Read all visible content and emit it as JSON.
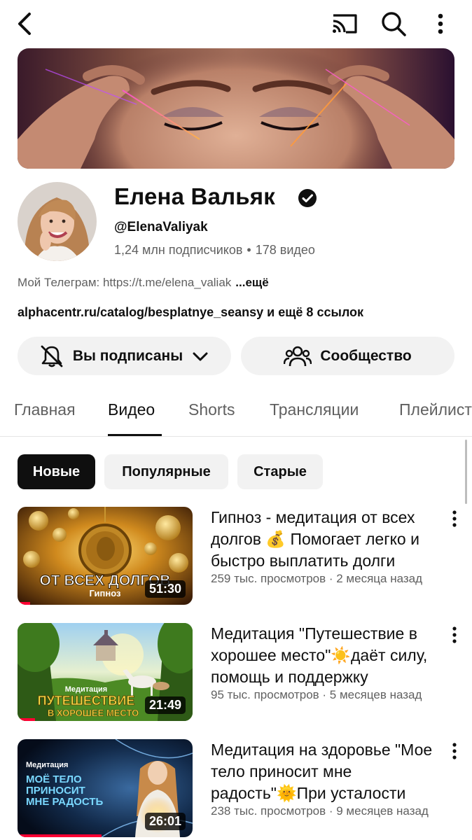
{
  "channel": {
    "name": "Елена Вальяк",
    "handle": "@ElenaValiyak",
    "subscribers": "1,24 млн подписчиков",
    "stats_separator": "•",
    "video_count": "178 видео",
    "description": "Мой Телеграм: https://t.me/elena_valiak",
    "description_more": "...ещё",
    "links": "alphacentr.ru/catalog/besplatnye_seansy и ещё 8 ссылок"
  },
  "actions": {
    "subscribed_label": "Вы подписаны",
    "community_label": "Сообщество"
  },
  "tabs": [
    {
      "label": "Главная",
      "active": false
    },
    {
      "label": "Видео",
      "active": true
    },
    {
      "label": "Shorts",
      "active": false
    },
    {
      "label": "Трансляции",
      "active": false
    },
    {
      "label": "Плейлисты",
      "active": false
    }
  ],
  "chips": [
    {
      "label": "Новые",
      "active": true
    },
    {
      "label": "Популярные",
      "active": false
    },
    {
      "label": "Старые",
      "active": false
    }
  ],
  "videos": [
    {
      "title": "Гипноз - медитация от всех долгов 💰 Помогает легко и быстро выплатить долги",
      "meta": "259 тыс. просмотров · 2 месяца назад",
      "duration": "51:30",
      "thumb_text_1": "ОТ ВСЕХ ДОЛГОВ",
      "thumb_text_2": "Гипноз",
      "watched_fraction": 0.07
    },
    {
      "title": "Медитация \"Путешествие в хорошее место\"☀️даёт силу, помощь и поддержку",
      "meta": "95 тыс. просмотров · 5 месяцев назад",
      "duration": "21:49",
      "thumb_text_1": "Медитация",
      "thumb_text_2": "ПУТЕШЕСТВИЕ",
      "thumb_text_3": "В ХОРОШЕЕ МЕСТО",
      "watched_fraction": 0.1
    },
    {
      "title": "Медитация на здоровье \"Мое тело приносит мне радость\"🌞При усталости",
      "meta": "238 тыс. просмотров · 9 месяцев назад",
      "duration": "26:01",
      "thumb_text_1": "Медитация",
      "thumb_text_2": "МОЁ ТЕЛО",
      "thumb_text_3": "ПРИНОСИТ",
      "thumb_text_4": "МНЕ РАДОСТЬ",
      "watched_fraction": 0.48
    }
  ],
  "colors": {
    "accent_red": "#ff0033",
    "chip_active_bg": "#0f0f0f",
    "button_bg": "#f2f2f2",
    "secondary_text": "#606060"
  }
}
